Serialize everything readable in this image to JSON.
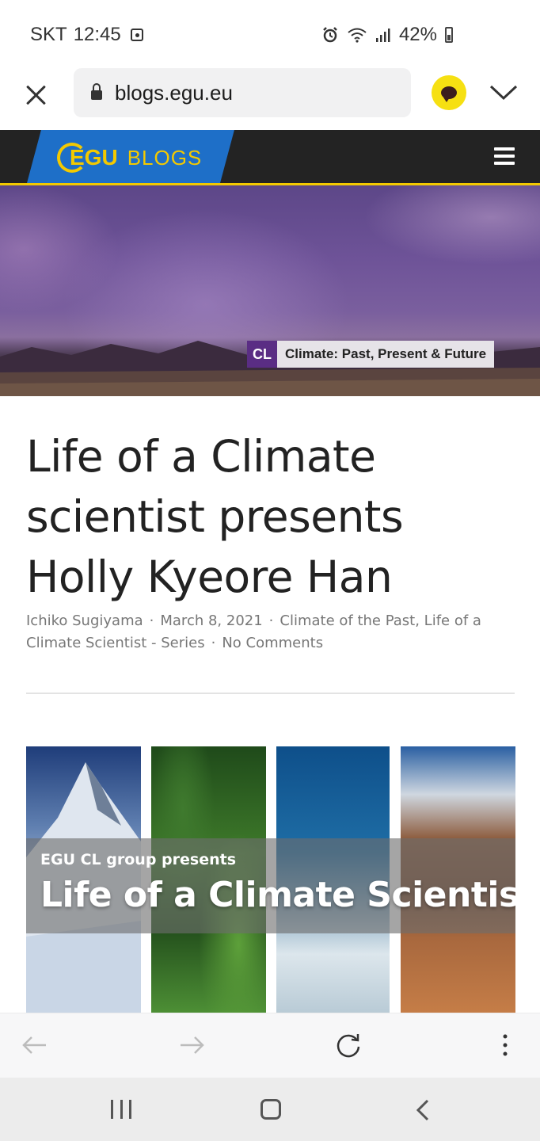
{
  "status_bar": {
    "carrier": "SKT",
    "time": "12:45",
    "battery": "42%",
    "icons": [
      "alarm-icon",
      "wifi-icon",
      "signal-icon",
      "battery-icon"
    ]
  },
  "browser": {
    "url": "blogs.egu.eu",
    "close_icon": "close-icon",
    "lock_icon": "lock-icon",
    "extension_icon": "kakaotalk-icon",
    "expand_icon": "chevron-down-icon"
  },
  "site_header": {
    "logo_text": "EGU",
    "brand_text": "BLOGS",
    "menu_icon": "hamburger-menu-icon",
    "colors": {
      "header_bg": "#232323",
      "logo_band": "#1e6fc8",
      "accent": "#f3c900"
    }
  },
  "hero": {
    "tag_code": "CL",
    "tag_name": "Climate: Past, Present & Future",
    "colors": {
      "tag_code_bg": "#5a2d84"
    }
  },
  "article": {
    "title": "Life of a Climate scientist presents Holly Kyeore Han",
    "author": "Ichiko Sugiyama",
    "date": "March 8, 2021",
    "categories": "Climate of the Past, Life of a Climate Scientist - Series",
    "comments": "No Comments"
  },
  "feature_image": {
    "subtitle": "EGU CL group presents",
    "title": "Life of a Climate Scientist"
  },
  "toolbar": {
    "back_icon": "arrow-left-icon",
    "forward_icon": "arrow-right-icon",
    "reload_icon": "reload-icon",
    "more_icon": "more-vertical-icon"
  },
  "android_nav": {
    "recent_icon": "recent-apps-icon",
    "home_icon": "home-icon",
    "back_icon": "back-icon"
  }
}
